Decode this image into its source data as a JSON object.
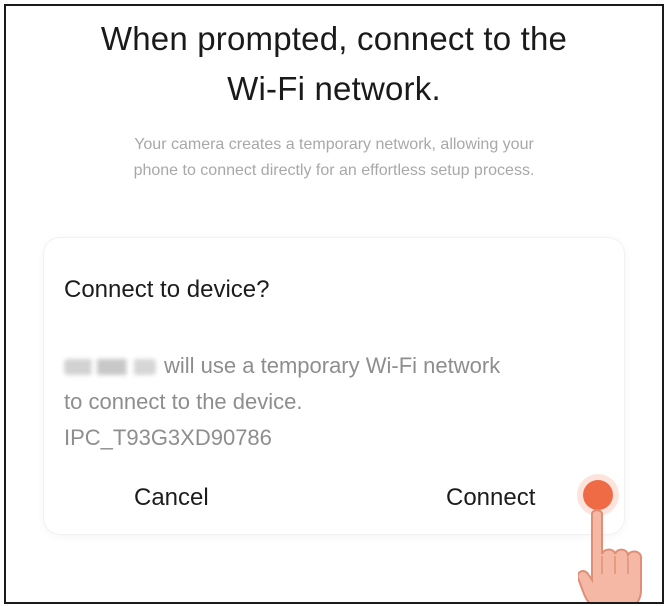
{
  "header": {
    "title_line1": "When prompted, connect to the",
    "title_line2": "Wi-Fi network.",
    "description_line1": "Your camera creates a temporary network, allowing your",
    "description_line2": "phone to connect directly for an effortless setup process."
  },
  "dialog": {
    "title": "Connect to device?",
    "body_line1_suffix": "will use a temporary Wi-Fi network",
    "body_line2": "to connect to the device.",
    "network_name": "IPC_T93G3XD90786",
    "cancel_label": "Cancel",
    "connect_label": "Connect"
  },
  "colors": {
    "tap_indicator": "#ee6b45",
    "hand_fill": "#f4b8a4"
  },
  "icons": {
    "tap_indicator": "tap-indicator-dot",
    "hand": "pointing-hand-icon"
  }
}
